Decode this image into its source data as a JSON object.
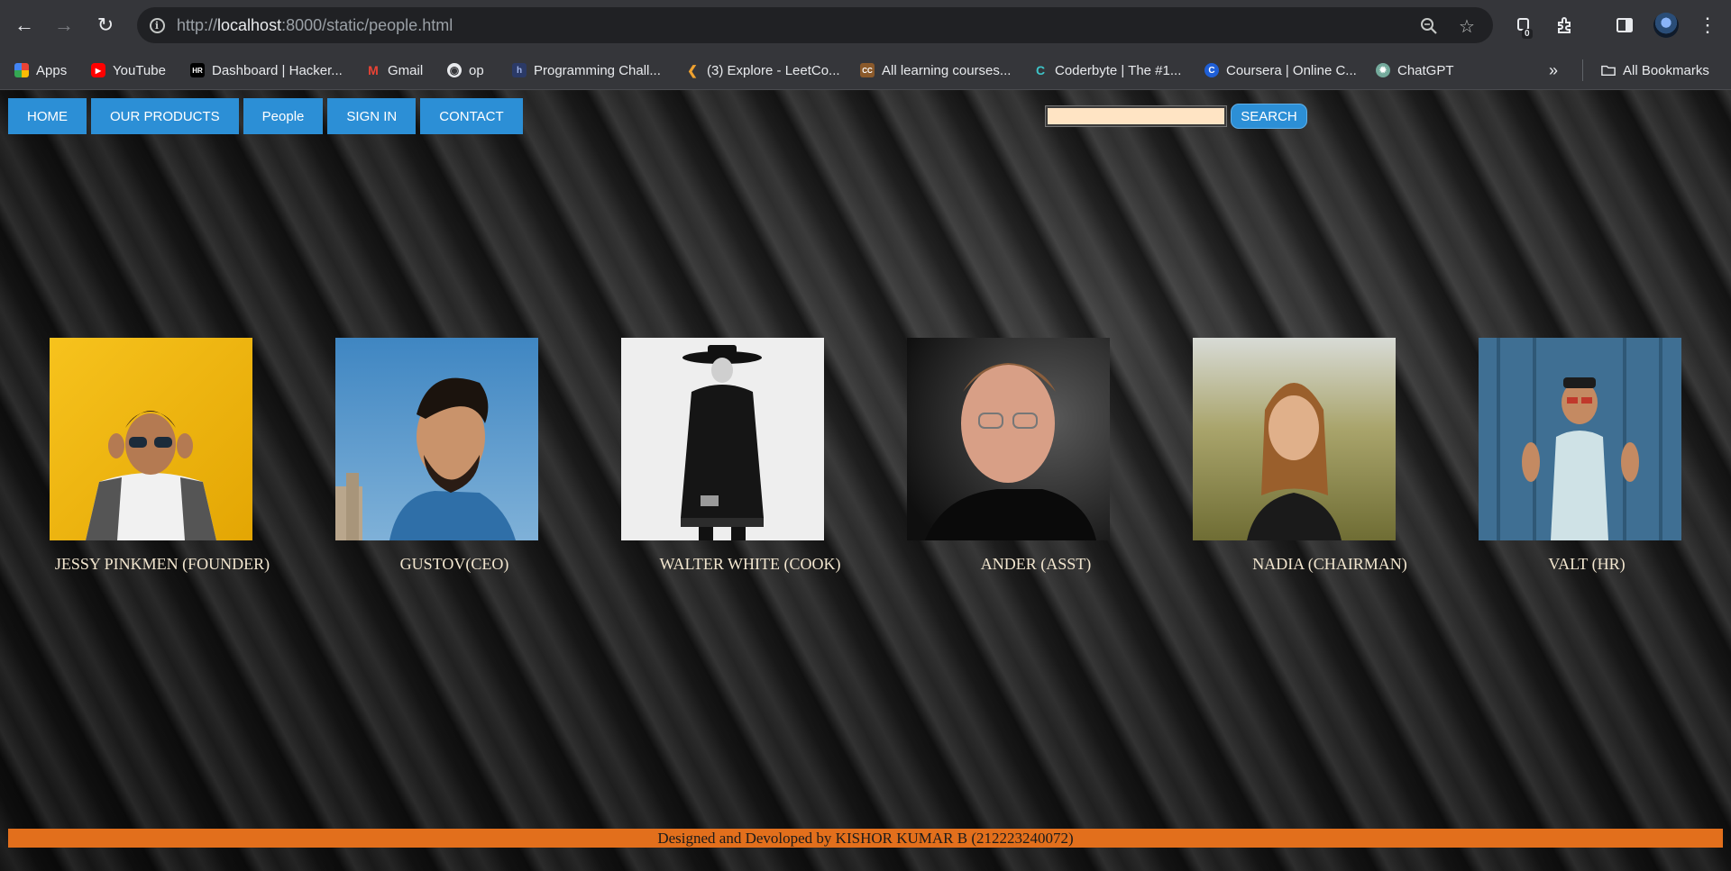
{
  "browser": {
    "url_prefix": "http://",
    "url_host": "localhost",
    "url_rest": ":8000/static/people.html",
    "extension_badge": "0"
  },
  "bookmarks": [
    {
      "label": "Apps",
      "icon": "apps-grid-icon"
    },
    {
      "label": "YouTube",
      "icon": "youtube-icon"
    },
    {
      "label": "Dashboard | Hacker...",
      "icon": "hackerrank-icon"
    },
    {
      "label": "Gmail",
      "icon": "gmail-icon"
    },
    {
      "label": "op",
      "icon": "globe-icon"
    },
    {
      "label": "Programming Chall...",
      "icon": "bookmark-site-icon"
    },
    {
      "label": "(3) Explore - LeetCo...",
      "icon": "leetcode-icon"
    },
    {
      "label": "All learning courses...",
      "icon": "codechef-icon"
    },
    {
      "label": "Coderbyte | The #1...",
      "icon": "coderbyte-icon"
    },
    {
      "label": "Coursera | Online C...",
      "icon": "coursera-icon"
    },
    {
      "label": "ChatGPT",
      "icon": "chatgpt-icon"
    }
  ],
  "all_bookmarks_label": "All Bookmarks",
  "site": {
    "nav": [
      "HOME",
      "OUR PRODUCTS",
      "People",
      "SIGN IN",
      "CONTACT"
    ],
    "search_value": "",
    "search_button": "SEARCH",
    "people": [
      {
        "caption": "JESSY PINKMEN (FOUNDER)"
      },
      {
        "caption": "GUSTOV(CEO)"
      },
      {
        "caption": "WALTER WHITE (COOK)"
      },
      {
        "caption": "ANDER (ASST)"
      },
      {
        "caption": "NADIA (CHAIRMAN)"
      },
      {
        "caption": "VALT (HR)"
      }
    ],
    "footer": "Designed and Devoloped by KISHOR KUMAR B (212223240072)"
  },
  "colors": {
    "nav_blue": "#2c8fd6",
    "footer_orange": "#e26f1c",
    "caption_text": "#f2e6cf",
    "search_bg": "#ffe4c4"
  }
}
